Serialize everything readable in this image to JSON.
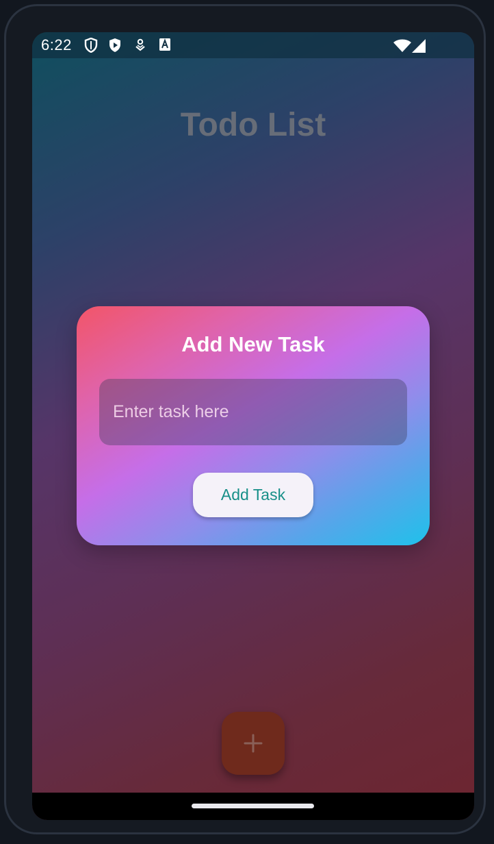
{
  "status_bar": {
    "time": "6:22",
    "left_icons": [
      "shield-icon",
      "play-protect-icon",
      "location-pin-icon",
      "font-a-icon"
    ],
    "right_icons": [
      "wifi-icon",
      "cell-signal-icon"
    ]
  },
  "app": {
    "title": "Todo List"
  },
  "dialog": {
    "title": "Add New Task",
    "input_placeholder": "Enter task here",
    "input_value": "",
    "add_button_label": "Add Task"
  },
  "fab": {
    "icon": "plus-icon",
    "color": "#6f2a1c"
  },
  "colors": {
    "accent_text": "#178f88",
    "dialog_gradient_start": "#f25568",
    "dialog_gradient_mid": "#c56ee8",
    "dialog_gradient_end": "#1fc1ea"
  }
}
